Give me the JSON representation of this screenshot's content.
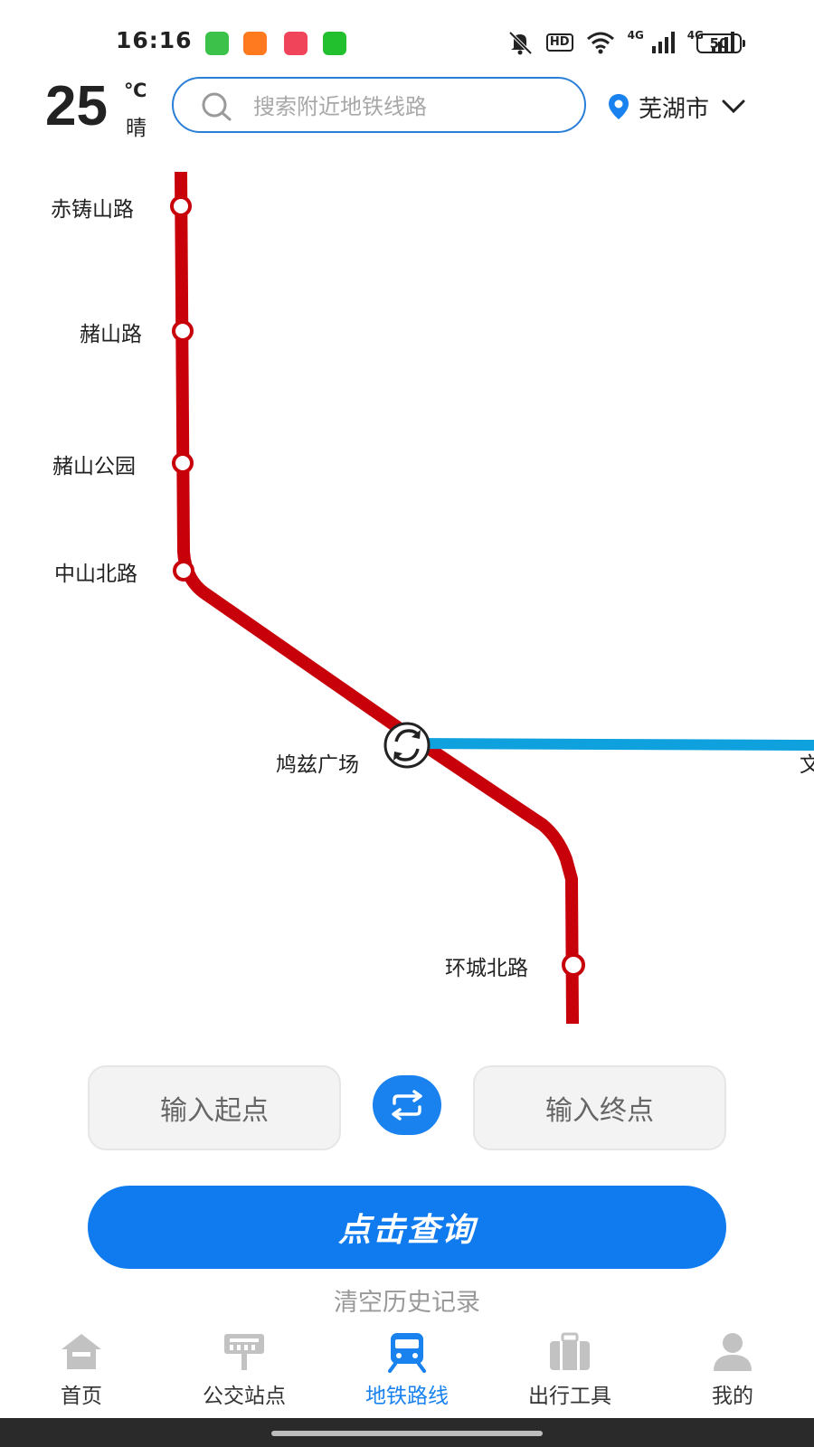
{
  "status_bar": {
    "time": "16:16",
    "hd_label": "HD",
    "net1": "4G",
    "net2": "4G",
    "battery": "50"
  },
  "header": {
    "temperature": "25",
    "unit": "℃",
    "weather": "晴",
    "search_placeholder": "搜索附近地铁线路",
    "city": "芜湖市"
  },
  "map": {
    "line_colors": {
      "line1": "#c8000a",
      "line2": "#0ea1dd"
    },
    "stations": [
      {
        "name": "赤铸山路"
      },
      {
        "name": "赭山路"
      },
      {
        "name": "赭山公园"
      },
      {
        "name": "中山北路"
      },
      {
        "name": "鸠兹广场",
        "transfer": true
      },
      {
        "name": "环城北路"
      },
      {
        "name": "文"
      }
    ]
  },
  "route_form": {
    "start_placeholder": "输入起点",
    "end_placeholder": "输入终点",
    "query_label": "点击查询",
    "clear_history": "清空历史记录"
  },
  "nav": {
    "items": [
      {
        "label": "首页",
        "icon": "home-icon",
        "active": false
      },
      {
        "label": "公交站点",
        "icon": "bus-stop-icon",
        "active": false
      },
      {
        "label": "地铁路线",
        "icon": "subway-icon",
        "active": true
      },
      {
        "label": "出行工具",
        "icon": "suitcase-icon",
        "active": false
      },
      {
        "label": "我的",
        "icon": "user-icon",
        "active": false
      }
    ]
  },
  "colors": {
    "accent": "#1a82ef",
    "nav_inactive_icon": "#c2c2c2"
  }
}
